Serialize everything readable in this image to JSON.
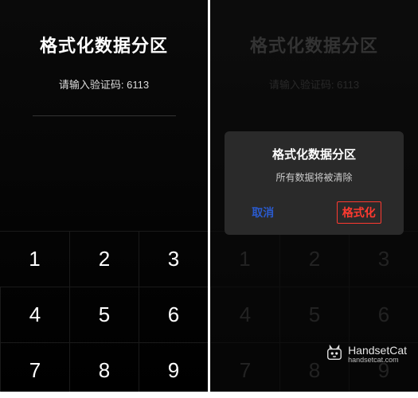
{
  "left": {
    "title": "格式化数据分区",
    "prompt": "请输入验证码: 6113",
    "keypad": [
      "1",
      "2",
      "3",
      "4",
      "5",
      "6",
      "7",
      "8",
      "9"
    ]
  },
  "right": {
    "title": "格式化数据分区",
    "prompt": "请输入验证码: 6113",
    "keypad": [
      "1",
      "2",
      "3",
      "4",
      "5",
      "6",
      "7",
      "8",
      "9"
    ],
    "dialog": {
      "title": "格式化数据分区",
      "message": "所有数据将被清除",
      "cancel": "取消",
      "confirm": "格式化"
    }
  },
  "watermark": {
    "text": "HandsetCat",
    "url": "handsetcat.com"
  }
}
